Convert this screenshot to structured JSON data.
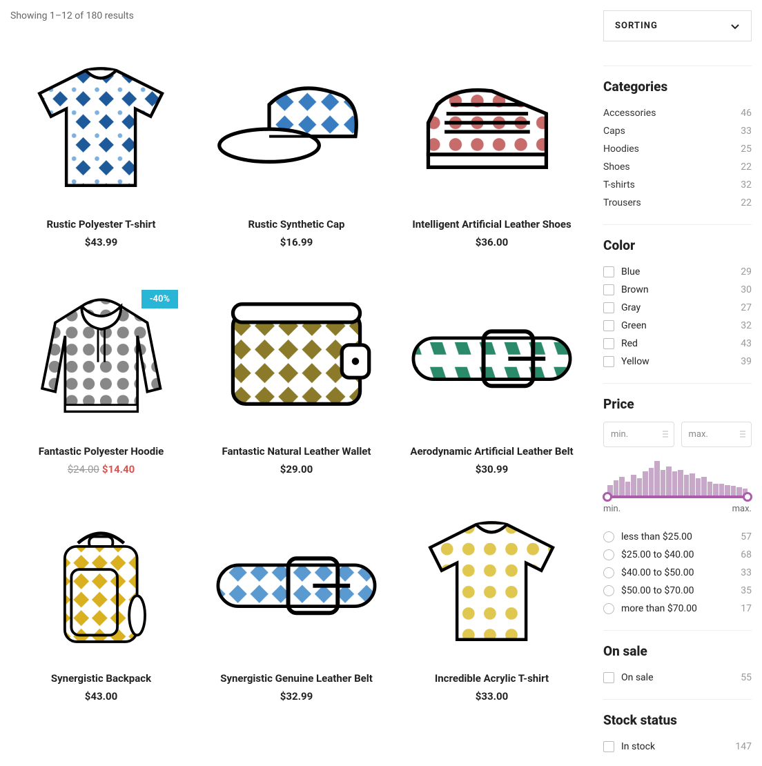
{
  "results_text": "Showing 1–12 of 180 results",
  "sorting_label": "SORTING",
  "products": [
    {
      "title": "Rustic Polyester T-shirt",
      "price": "$43.99"
    },
    {
      "title": "Rustic Synthetic Cap",
      "price": "$16.99"
    },
    {
      "title": "Intelligent Artificial Leather Shoes",
      "price": "$36.00"
    },
    {
      "title": "Fantastic Polyester Hoodie",
      "price_old": "$24.00",
      "price_sale": "$14.40",
      "badge": "-40%"
    },
    {
      "title": "Fantastic Natural Leather Wallet",
      "price": "$29.00"
    },
    {
      "title": "Aerodynamic Artificial Leather Belt",
      "price": "$30.99"
    },
    {
      "title": "Synergistic Backpack",
      "price": "$43.00"
    },
    {
      "title": "Synergistic Genuine Leather Belt",
      "price": "$32.99"
    },
    {
      "title": "Incredible Acrylic T-shirt",
      "price": "$33.00"
    }
  ],
  "sidebar": {
    "categories_title": "Categories",
    "categories": [
      {
        "name": "Accessories",
        "count": "46"
      },
      {
        "name": "Caps",
        "count": "33"
      },
      {
        "name": "Hoodies",
        "count": "25"
      },
      {
        "name": "Shoes",
        "count": "22"
      },
      {
        "name": "T-shirts",
        "count": "32"
      },
      {
        "name": "Trousers",
        "count": "22"
      }
    ],
    "color_title": "Color",
    "colors": [
      {
        "name": "Blue",
        "count": "29"
      },
      {
        "name": "Brown",
        "count": "30"
      },
      {
        "name": "Gray",
        "count": "27"
      },
      {
        "name": "Green",
        "count": "32"
      },
      {
        "name": "Red",
        "count": "43"
      },
      {
        "name": "Yellow",
        "count": "39"
      }
    ],
    "price_title": "Price",
    "price_min_placeholder": "min.",
    "price_max_placeholder": "max.",
    "slider_min_label": "min.",
    "slider_max_label": "max.",
    "price_ranges": [
      {
        "name": "less than $25.00",
        "count": "57"
      },
      {
        "name": "$25.00 to $40.00",
        "count": "68"
      },
      {
        "name": "$40.00 to $50.00",
        "count": "33"
      },
      {
        "name": "$50.00 to $70.00",
        "count": "35"
      },
      {
        "name": "more than $70.00",
        "count": "17"
      }
    ],
    "onsale_title": "On sale",
    "onsale_label": "On sale",
    "onsale_count": "55",
    "stock_title": "Stock status",
    "stock_label": "In stock",
    "stock_count": "147"
  },
  "chart_data": {
    "type": "bar",
    "title": "Price distribution histogram",
    "values": [
      12,
      18,
      22,
      16,
      24,
      20,
      28,
      32,
      40,
      30,
      34,
      28,
      30,
      24,
      26,
      20,
      22,
      16,
      14,
      14,
      12,
      11,
      10,
      8
    ]
  }
}
